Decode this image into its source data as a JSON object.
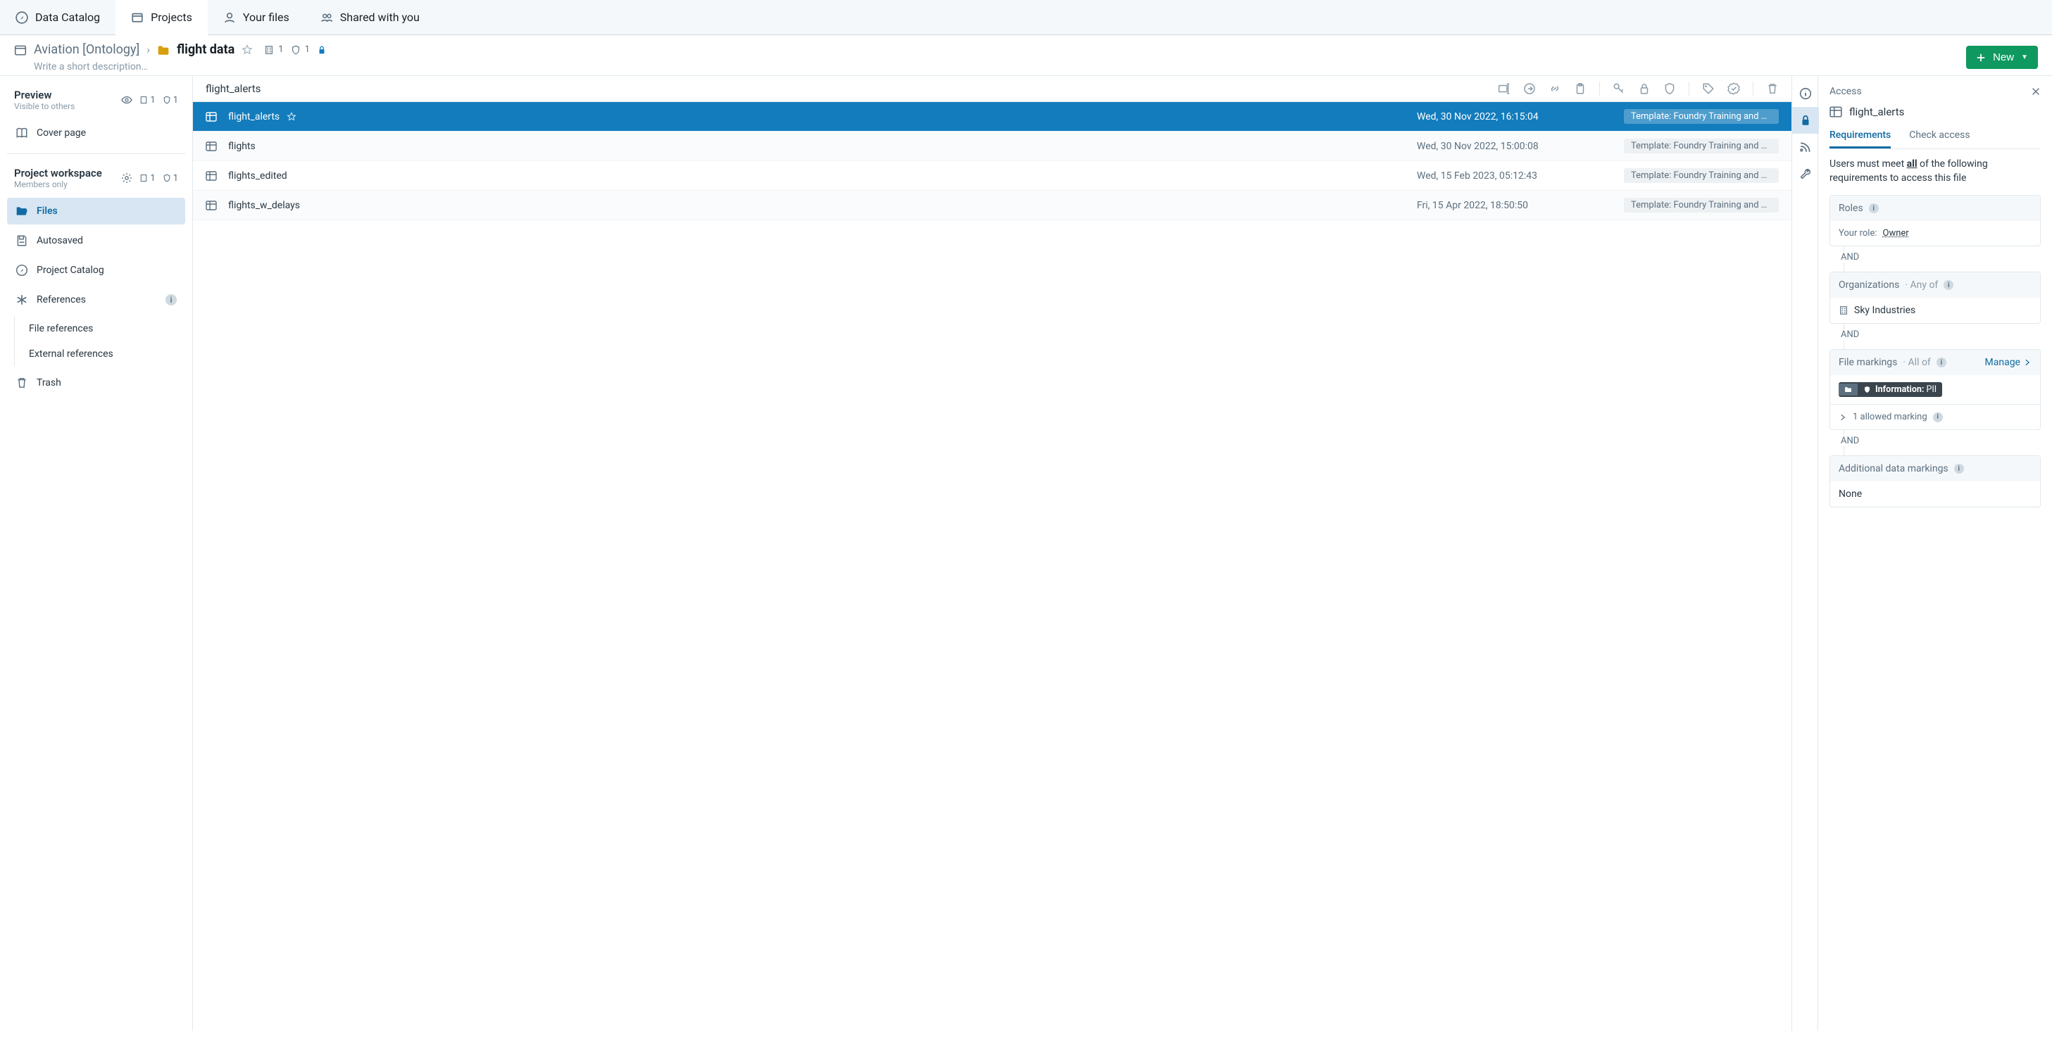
{
  "topTabs": [
    {
      "label": "Data Catalog"
    },
    {
      "label": "Projects"
    },
    {
      "label": "Your files"
    },
    {
      "label": "Shared with you"
    }
  ],
  "breadcrumb": {
    "parent": "Aviation [Ontology]",
    "folder": "flight data",
    "meta1": "1",
    "meta2": "1",
    "descPlaceholder": "Write a short description…"
  },
  "newButton": "New",
  "sidebar": {
    "preview": {
      "title": "Preview",
      "sub": "Visible to others",
      "m1": "1",
      "m2": "1"
    },
    "coverPage": "Cover page",
    "workspace": {
      "title": "Project workspace",
      "sub": "Members only",
      "m1": "1",
      "m2": "1"
    },
    "files": "Files",
    "autosaved": "Autosaved",
    "projectCatalog": "Project Catalog",
    "references": "References",
    "fileRefs": "File references",
    "extRefs": "External references",
    "trash": "Trash"
  },
  "toolbar": {
    "selectedName": "flight_alerts"
  },
  "files": [
    {
      "name": "flight_alerts",
      "date": "Wed, 30 Nov 2022, 16:15:04",
      "badge": "Template: Foundry Training and …"
    },
    {
      "name": "flights",
      "date": "Wed, 30 Nov 2022, 15:00:08",
      "badge": "Template: Foundry Training and …"
    },
    {
      "name": "flights_edited",
      "date": "Wed, 15 Feb 2023, 05:12:43",
      "badge": "Template: Foundry Training and …"
    },
    {
      "name": "flights_w_delays",
      "date": "Fri, 15 Apr 2022, 18:50:50",
      "badge": "Template: Foundry Training and …"
    }
  ],
  "panel": {
    "title": "Access",
    "file": "flight_alerts",
    "tabReq": "Requirements",
    "tabCheck": "Check access",
    "reqPrefix": "Users must meet ",
    "reqAll": "all",
    "reqSuffix": " of the following requirements to access this file",
    "rolesTitle": "Roles",
    "yourRoleLabel": "Your role: ",
    "yourRoleValue": "Owner",
    "and": "AND",
    "orgTitle": "Organizations",
    "orgQual": "· Any of",
    "orgName": "Sky Industries",
    "markTitle": "File markings",
    "markQual": "· All of",
    "manage": "Manage",
    "pillPrefix": "Information:",
    "pillValue": " PII",
    "allowed": "1 allowed marking",
    "addlTitle": "Additional data markings",
    "none": "None"
  }
}
